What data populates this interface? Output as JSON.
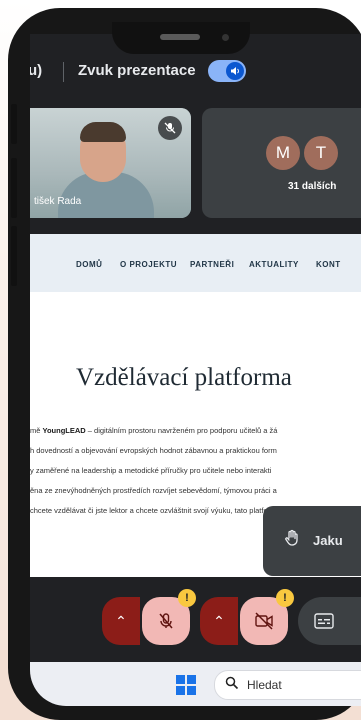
{
  "meet": {
    "top_left_text": "u)",
    "presentation_audio_label": "Zvuk prezentace",
    "toggle_icon": "volume-icon",
    "participant": {
      "name": "tišek Rada",
      "mic_icon": "mic-off-icon"
    },
    "others": {
      "avatars": [
        "M",
        "T"
      ],
      "count_label": "31 dalších"
    },
    "raise_hand": {
      "icon": "hand-icon",
      "label": "Jaku"
    },
    "warning_symbol": "!",
    "controls_icons": [
      "chevron-up-icon",
      "mic-off-icon",
      "chevron-up-icon",
      "camera-off-icon",
      "captions-icon"
    ]
  },
  "website": {
    "nav": [
      "DOMŮ",
      "O PROJEKTU",
      "PARTNEŘI",
      "AKTUALITY",
      "KONT"
    ],
    "title": "Vzdělávací platforma",
    "paragraph": [
      {
        "bold": "YoungLEAD",
        "prefix": "mě ",
        "rest": " – digitálním prostoru navrženém pro podporu učitelů a žá"
      },
      {
        "text": "h dovedností a objevování evropských hodnot zábavnou a praktickou form"
      },
      {
        "text": "y zaměřené na leadership a metodické příručky pro učitele nebo interakti"
      },
      {
        "text": "ěna ze znevýhodněných prostředích rozvíjet sebevědomí, týmovou práci a"
      },
      {
        "text": "chcete vzdělávat či jste lektor a chcete ozvláštnit svojí výuku, tato platforn"
      }
    ]
  },
  "taskbar": {
    "search_placeholder": "Hledat"
  },
  "colors": {
    "meet_bg": "#202124",
    "toggle_on": "#8ab4f8",
    "mic_off_bg": "#f2b8b5",
    "danger": "#8c1d18",
    "warning": "#f9c83f"
  }
}
